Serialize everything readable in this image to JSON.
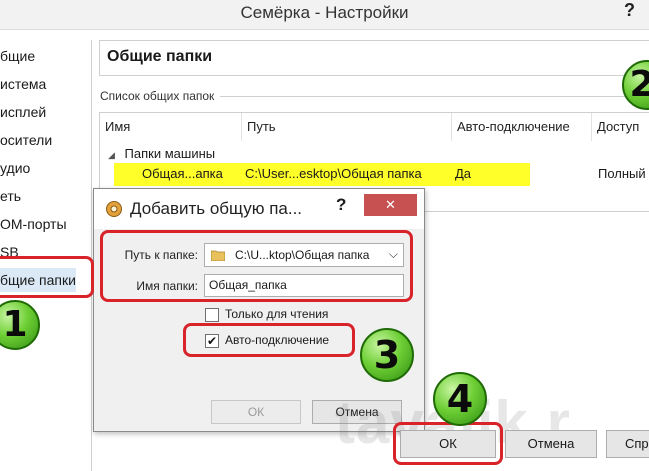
{
  "window": {
    "title": "Семёрка - Настройки",
    "help": "?"
  },
  "sidebar": {
    "items": [
      {
        "label": "бщие"
      },
      {
        "label": "истема"
      },
      {
        "label": "исплей"
      },
      {
        "label": "осители"
      },
      {
        "label": "удио"
      },
      {
        "label": "еть"
      },
      {
        "label": "OM-порты"
      },
      {
        "label": "SB"
      },
      {
        "label": "бщие папки"
      }
    ]
  },
  "section": {
    "title": "Общие папки",
    "list_caption": "Список общих папок",
    "columns": [
      "Имя",
      "Путь",
      "Авто-подключение",
      "Доступ"
    ],
    "group": {
      "toggle": "◢",
      "label": "Папки машины"
    },
    "row": {
      "name": "Общая...апка",
      "path": "C:\\User...esktop\\Общая папка",
      "auto": "Да",
      "access": "Полный"
    }
  },
  "dialog": {
    "title": "Добавить общую па...",
    "help": "?",
    "close": "✕",
    "path_label": "Путь к папке:",
    "path_value": "C:\\U...ktop\\Общая папка",
    "name_label": "Имя папки:",
    "name_value": "Общая_папка",
    "readonly_label": "Только для чтения",
    "readonly_checked": false,
    "auto_label": "Авто-подключение",
    "auto_checked": true,
    "ok": "ОК",
    "cancel": "Отмена"
  },
  "buttons": {
    "ok": "ОК",
    "cancel": "Отмена",
    "help": "Спр"
  },
  "badges": [
    "1",
    "2",
    "3",
    "4"
  ],
  "watermark": "tavalik.r",
  "colors": {
    "highlight": "#d8232a",
    "row": "#ffff29",
    "badge": "#6fcf36",
    "close": "#c75050"
  }
}
